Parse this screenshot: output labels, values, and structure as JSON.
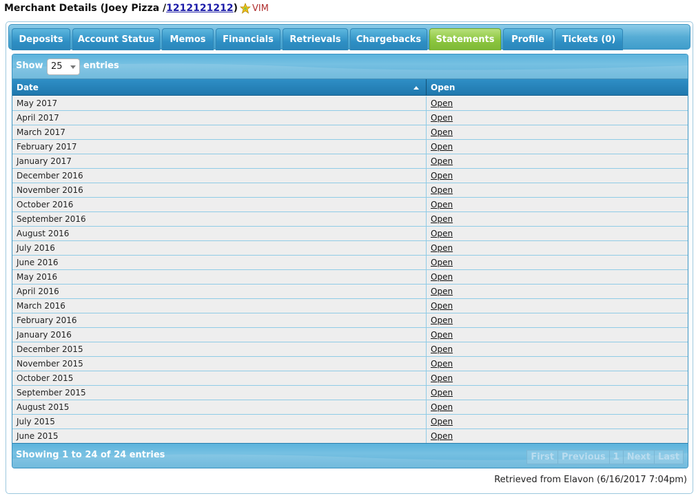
{
  "header": {
    "prefix": "Merchant Details (Joey Pizza /",
    "merchant_id": "1212121212",
    "suffix": ")",
    "badge": "VIM"
  },
  "tabs": [
    {
      "label": "Deposits",
      "active": false
    },
    {
      "label": "Account Status",
      "active": false
    },
    {
      "label": "Memos",
      "active": false
    },
    {
      "label": "Financials",
      "active": false
    },
    {
      "label": "Retrievals",
      "active": false
    },
    {
      "label": "Chargebacks",
      "active": false
    },
    {
      "label": "Statements",
      "active": true
    },
    {
      "label": "Profile",
      "active": false
    },
    {
      "label": "Tickets (0)",
      "active": false
    }
  ],
  "toolbar": {
    "show_label": "Show",
    "entries_label": "entries",
    "page_size": "25"
  },
  "table": {
    "columns": [
      "Date",
      "Open"
    ],
    "link_label": "Open",
    "rows": [
      "May 2017",
      "April 2017",
      "March 2017",
      "February 2017",
      "January 2017",
      "December 2016",
      "November 2016",
      "October 2016",
      "September 2016",
      "August 2016",
      "July 2016",
      "June 2016",
      "May 2016",
      "April 2016",
      "March 2016",
      "February 2016",
      "January 2016",
      "December 2015",
      "November 2015",
      "October 2015",
      "September 2015",
      "August 2015",
      "July 2015",
      "June 2015"
    ]
  },
  "footer": {
    "info": "Showing 1 to 24 of 24 entries",
    "pager": {
      "first": "First",
      "previous": "Previous",
      "page": "1",
      "next": "Next",
      "last": "Last"
    }
  },
  "retrieved": "Retrieved from Elavon (6/16/2017 7:04pm)",
  "colors": {
    "tab": "#2e8fc4",
    "active_tab": "#8cc63f",
    "header": "#1f78ad"
  }
}
